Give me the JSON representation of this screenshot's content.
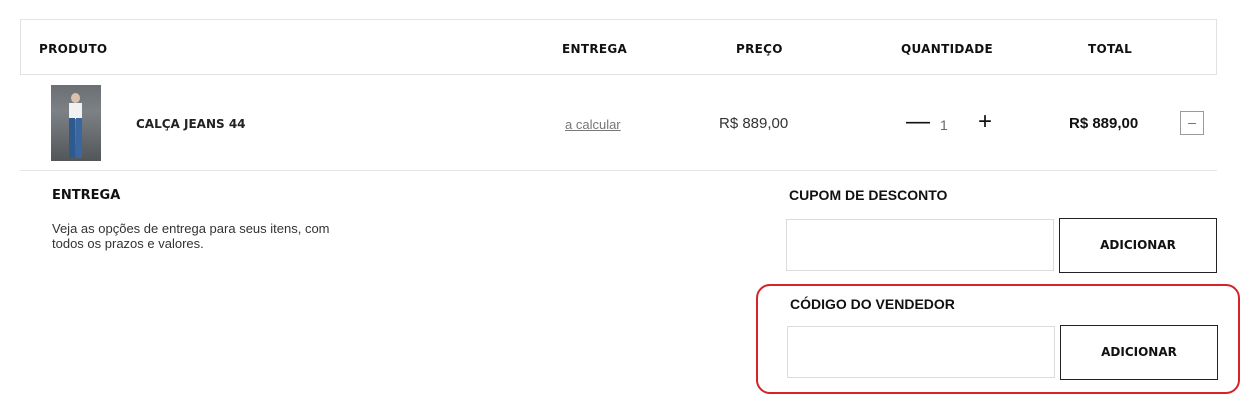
{
  "table_header": {
    "product": "PRODUTO",
    "delivery": "ENTREGA",
    "price": "PREÇO",
    "quantity": "QUANTIDADE",
    "total": "TOTAL"
  },
  "cart_item": {
    "thumbnail_icon": "product-photo-jeans",
    "name": "CALÇA JEANS 44",
    "delivery_link": "a calcular",
    "price": "R$ 889,00",
    "quantity": "1",
    "minus_symbol": "—",
    "plus_symbol": "+",
    "total": "R$ 889,00",
    "remove_symbol": "–"
  },
  "shipping": {
    "title": "ENTREGA",
    "description": "Veja as opções de entrega para seus itens, com todos os prazos e valores."
  },
  "coupon": {
    "label": "CUPOM DE DESCONTO",
    "value": "",
    "button": "ADICIONAR"
  },
  "seller_code": {
    "label": "CÓDIGO DO VENDEDOR",
    "value": "",
    "button": "ADICIONAR"
  },
  "colors": {
    "highlight": "#d4242a",
    "text": "#111111"
  }
}
